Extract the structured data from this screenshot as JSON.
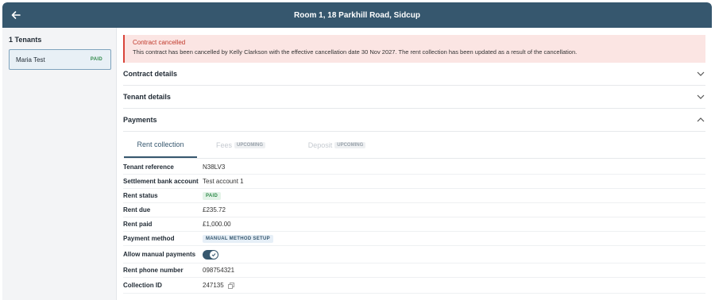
{
  "header": {
    "title": "Room 1, 18 Parkhill Road, Sidcup",
    "back_icon": "arrow-left-icon"
  },
  "sidebar": {
    "count_label": "1 Tenants",
    "tenants": [
      {
        "name": "Maria Test",
        "status": "PAID"
      }
    ]
  },
  "alert": {
    "title": "Contract cancelled",
    "text": "This contract has been cancelled by Kelly Clarkson with the effective cancellation date 30 Nov 2027. The rent collection has been updated as a result of the cancellation."
  },
  "sections": {
    "contract": "Contract details",
    "tenant": "Tenant details",
    "payments": "Payments"
  },
  "tabs": {
    "rent": "Rent collection",
    "fees": "Fees",
    "fees_badge": "UPCOMING",
    "deposit": "Deposit",
    "deposit_badge": "UPCOMING"
  },
  "details": {
    "tenant_reference": {
      "label": "Tenant reference",
      "value": "N38LV3"
    },
    "settlement_account": {
      "label": "Settlement bank account",
      "value": "Test account 1"
    },
    "rent_status": {
      "label": "Rent status",
      "value": "PAID"
    },
    "rent_due": {
      "label": "Rent due",
      "value": "£235.72"
    },
    "rent_paid": {
      "label": "Rent paid",
      "value": "£1,000.00"
    },
    "payment_method": {
      "label": "Payment method",
      "value": "MANUAL METHOD SETUP"
    },
    "allow_manual": {
      "label": "Allow manual payments",
      "value": true
    },
    "rent_phone": {
      "label": "Rent phone number",
      "value": "098754321"
    },
    "collection_id": {
      "label": "Collection ID",
      "value": "247135"
    }
  },
  "colors": {
    "header": "#36576e",
    "alert_bg": "#fbe5e3",
    "alert_title": "#c0392b",
    "paid": "#2f8a4a"
  }
}
